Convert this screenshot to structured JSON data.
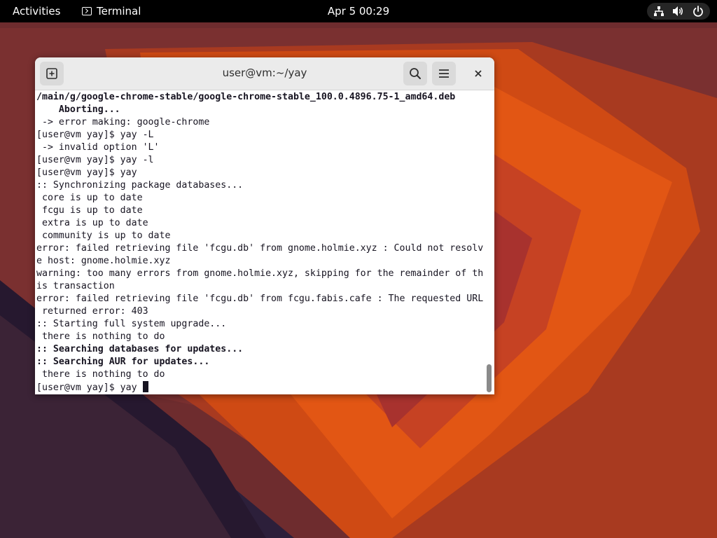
{
  "topbar": {
    "activities": "Activities",
    "app_name": "Terminal",
    "clock": "Apr 5  00:29",
    "icons": [
      "network-icon",
      "volume-icon",
      "power-icon"
    ]
  },
  "terminal": {
    "title": "user@vm:~/yay",
    "buttons": [
      "new-tab-icon",
      "search-icon",
      "menu-icon",
      "close-icon"
    ],
    "lines": [
      {
        "text": "/main/g/google-chrome-stable/google-chrome-stable_100.0.4896.75-1_amd64.deb",
        "bold": true
      },
      {
        "text": "    Aborting...",
        "bold": true
      },
      {
        "text": " -> error making: google-chrome",
        "bold": false
      },
      {
        "text": "[user@vm yay]$ yay -L",
        "bold": false
      },
      {
        "text": " -> invalid option 'L'",
        "bold": false
      },
      {
        "text": "[user@vm yay]$ yay -l",
        "bold": false
      },
      {
        "text": "[user@vm yay]$ yay",
        "bold": false
      },
      {
        "text": ":: Synchronizing package databases...",
        "bold": false
      },
      {
        "text": " core is up to date",
        "bold": false
      },
      {
        "text": " fcgu is up to date",
        "bold": false
      },
      {
        "text": " extra is up to date",
        "bold": false
      },
      {
        "text": " community is up to date",
        "bold": false
      },
      {
        "text": "error: failed retrieving file 'fcgu.db' from gnome.holmie.xyz : Could not resolv",
        "bold": false
      },
      {
        "text": "e host: gnome.holmie.xyz",
        "bold": false
      },
      {
        "text": "warning: too many errors from gnome.holmie.xyz, skipping for the remainder of th",
        "bold": false
      },
      {
        "text": "is transaction",
        "bold": false
      },
      {
        "text": "error: failed retrieving file 'fcgu.db' from fcgu.fabis.cafe : The requested URL",
        "bold": false
      },
      {
        "text": " returned error: 403",
        "bold": false
      },
      {
        "text": ":: Starting full system upgrade...",
        "bold": false
      },
      {
        "text": " there is nothing to do",
        "bold": false
      },
      {
        "text": ":: Searching databases for updates...",
        "bold": true
      },
      {
        "text": ":: Searching AUR for updates...",
        "bold": true
      },
      {
        "text": " there is nothing to do",
        "bold": false
      }
    ],
    "prompt": "[user@vm yay]$ yay "
  },
  "colors": {
    "wallpaper_dark": "#2c1f3a",
    "wallpaper_orange": "#e3540e",
    "topbar": "#000000",
    "terminal_bg": "#ffffff",
    "terminal_text": "#171421"
  }
}
